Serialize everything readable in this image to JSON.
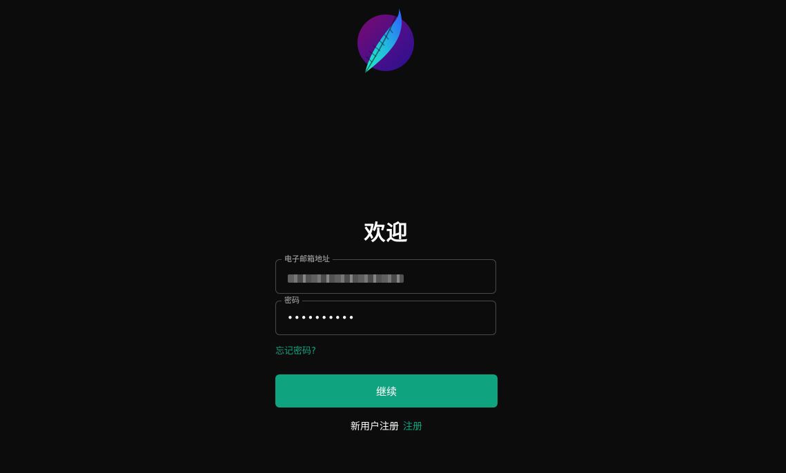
{
  "logo": {
    "icon": "feather-logo-icon",
    "colors": [
      "#3a0f8c",
      "#7a0a6e",
      "#1ad6c4",
      "#2f6bff"
    ]
  },
  "title": "欢迎",
  "form": {
    "email": {
      "label": "电子邮箱地址",
      "value_redacted": true
    },
    "password": {
      "label": "密码",
      "value": "••••••••••"
    },
    "forgot_password": "忘记密码?",
    "continue_label": "继续",
    "signup_prompt": "新用户注册",
    "signup_link": "注册"
  },
  "theme": {
    "background": "#0c0c0c",
    "accent": "#10a37f",
    "border": "#4a4a4a"
  }
}
